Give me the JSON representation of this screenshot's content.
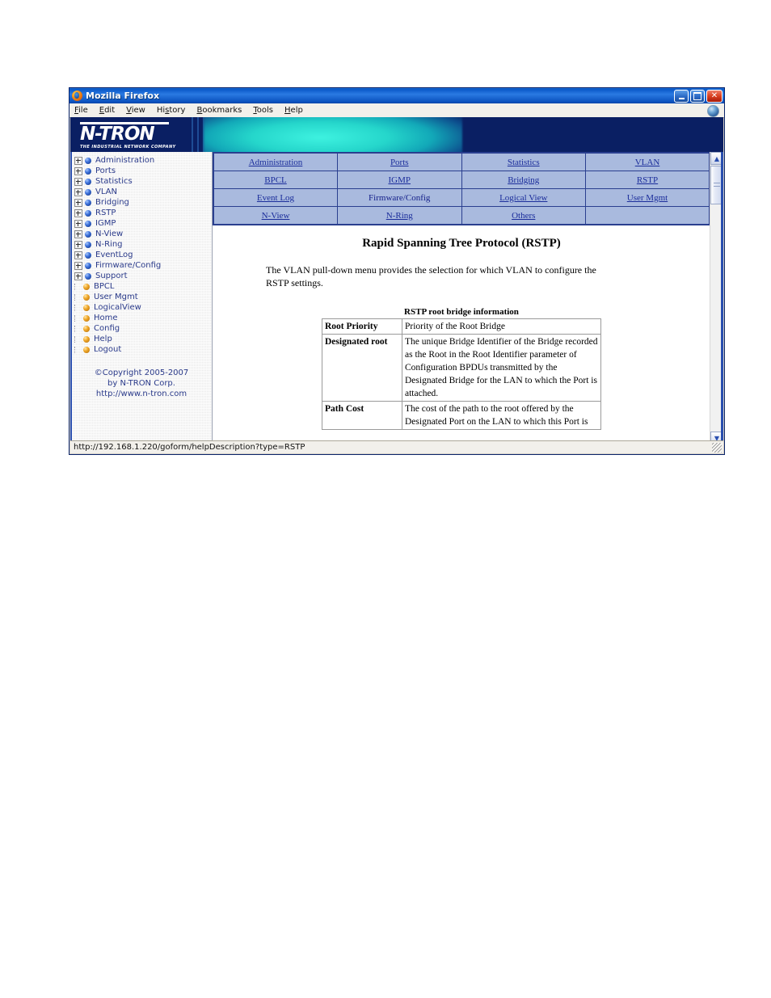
{
  "window": {
    "title": "Mozilla Firefox",
    "icon": "firefox-icon",
    "buttons": {
      "minimize": "_",
      "maximize": "□",
      "close": "✕"
    }
  },
  "menubar": {
    "items": [
      {
        "label": "File",
        "accel": "F"
      },
      {
        "label": "Edit",
        "accel": "E"
      },
      {
        "label": "View",
        "accel": "V"
      },
      {
        "label": "History",
        "accel": "s"
      },
      {
        "label": "Bookmarks",
        "accel": "B"
      },
      {
        "label": "Tools",
        "accel": "T"
      },
      {
        "label": "Help",
        "accel": "H"
      }
    ]
  },
  "banner": {
    "logo_word": "N-TRON",
    "logo_tagline": "THE INDUSTRIAL NETWORK COMPANY",
    "bg_color": "#0a1f63",
    "accent_color": "#25d6cb"
  },
  "sidebar": {
    "tree": [
      {
        "label": "Administration",
        "expandable": true,
        "bullet": "blue"
      },
      {
        "label": "Ports",
        "expandable": true,
        "bullet": "blue"
      },
      {
        "label": "Statistics",
        "expandable": true,
        "bullet": "blue"
      },
      {
        "label": "VLAN",
        "expandable": true,
        "bullet": "blue"
      },
      {
        "label": "Bridging",
        "expandable": true,
        "bullet": "blue"
      },
      {
        "label": "RSTP",
        "expandable": true,
        "bullet": "blue"
      },
      {
        "label": "IGMP",
        "expandable": true,
        "bullet": "blue"
      },
      {
        "label": "N-View",
        "expandable": true,
        "bullet": "blue"
      },
      {
        "label": "N-Ring",
        "expandable": true,
        "bullet": "blue"
      },
      {
        "label": "EventLog",
        "expandable": true,
        "bullet": "blue"
      },
      {
        "label": "Firmware/Config",
        "expandable": true,
        "bullet": "blue"
      },
      {
        "label": "Support",
        "expandable": true,
        "bullet": "blue"
      },
      {
        "label": "BPCL",
        "expandable": false,
        "bullet": "orange"
      },
      {
        "label": "User Mgmt",
        "expandable": false,
        "bullet": "orange"
      },
      {
        "label": "LogicalView",
        "expandable": false,
        "bullet": "orange"
      },
      {
        "label": "Home",
        "expandable": false,
        "bullet": "orange"
      },
      {
        "label": "Config",
        "expandable": false,
        "bullet": "orange"
      },
      {
        "label": "Help",
        "expandable": false,
        "bullet": "orange"
      },
      {
        "label": "Logout",
        "expandable": false,
        "bullet": "orange"
      }
    ],
    "copyright": {
      "line1": "©Copyright 2005-2007",
      "line2": "by N-TRON Corp.",
      "line3": "http://www.n-tron.com"
    }
  },
  "navtable": {
    "rows": [
      [
        {
          "label": "Administration",
          "link": true
        },
        {
          "label": "Ports",
          "link": true
        },
        {
          "label": "Statistics",
          "link": true
        },
        {
          "label": "VLAN",
          "link": true
        }
      ],
      [
        {
          "label": "BPCL",
          "link": true
        },
        {
          "label": "IGMP",
          "link": true
        },
        {
          "label": "Bridging",
          "link": true
        },
        {
          "label": "RSTP",
          "link": true
        }
      ],
      [
        {
          "label": "Event Log",
          "link": true
        },
        {
          "label": "Firmware/Config",
          "link": false
        },
        {
          "label": "Logical View",
          "link": true
        },
        {
          "label": "User Mgmt",
          "link": true
        }
      ],
      [
        {
          "label": "N-View",
          "link": true
        },
        {
          "label": "N-Ring",
          "link": true
        },
        {
          "label": "Others",
          "link": true
        },
        {
          "label": "",
          "link": false
        }
      ]
    ]
  },
  "document": {
    "title": "Rapid Spanning Tree Protocol (RSTP)",
    "intro": "The VLAN pull-down menu provides the selection for which VLAN to configure the RSTP settings.",
    "table_caption": "RSTP root bridge information",
    "rows": [
      {
        "key": "Root Priority",
        "value": "Priority of the Root Bridge"
      },
      {
        "key": "Designated root",
        "value": "The unique Bridge Identifier of the Bridge recorded as the Root in the Root Identifier parameter of Configuration BPDUs transmitted by the Designated Bridge for the LAN to which the Port is attached."
      },
      {
        "key": "Path Cost",
        "value": "The cost of the path to the root offered by the Designated Port on the LAN to which this Port is"
      }
    ]
  },
  "scrollbar": {
    "up_arrow": "▲",
    "down_arrow": "▼"
  },
  "statusbar": {
    "text": "http://192.168.1.220/goform/helpDescription?type=RSTP"
  }
}
